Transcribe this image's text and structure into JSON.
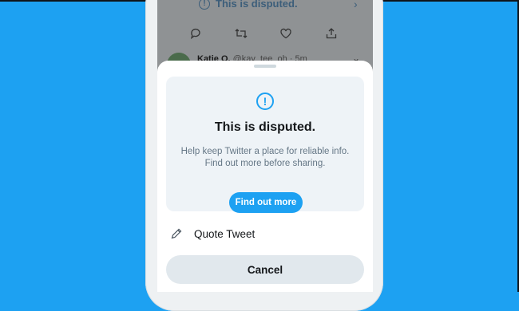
{
  "feed": {
    "disputed_label": "This is disputed.",
    "tweet2_name": "Katie O.",
    "tweet2_handle": "@kay_tee_oh",
    "tweet2_time": "5m"
  },
  "prompt": {
    "title": "This is disputed.",
    "body": "Help keep Twitter a place for reliable info. Find out more before sharing.",
    "find_out_more": "Find out more"
  },
  "menu": {
    "quote_tweet": "Quote Tweet",
    "cancel": "Cancel"
  },
  "colors": {
    "background": "#1da1f2",
    "accent": "#1da1f2",
    "card": "#eef3f7",
    "cancel": "#e1e8ed"
  },
  "icons": [
    "exclamation-circle-icon",
    "chevron-right-icon",
    "reply-icon",
    "retweet-icon",
    "like-icon",
    "share-icon",
    "chevron-down-icon",
    "pencil-icon"
  ]
}
